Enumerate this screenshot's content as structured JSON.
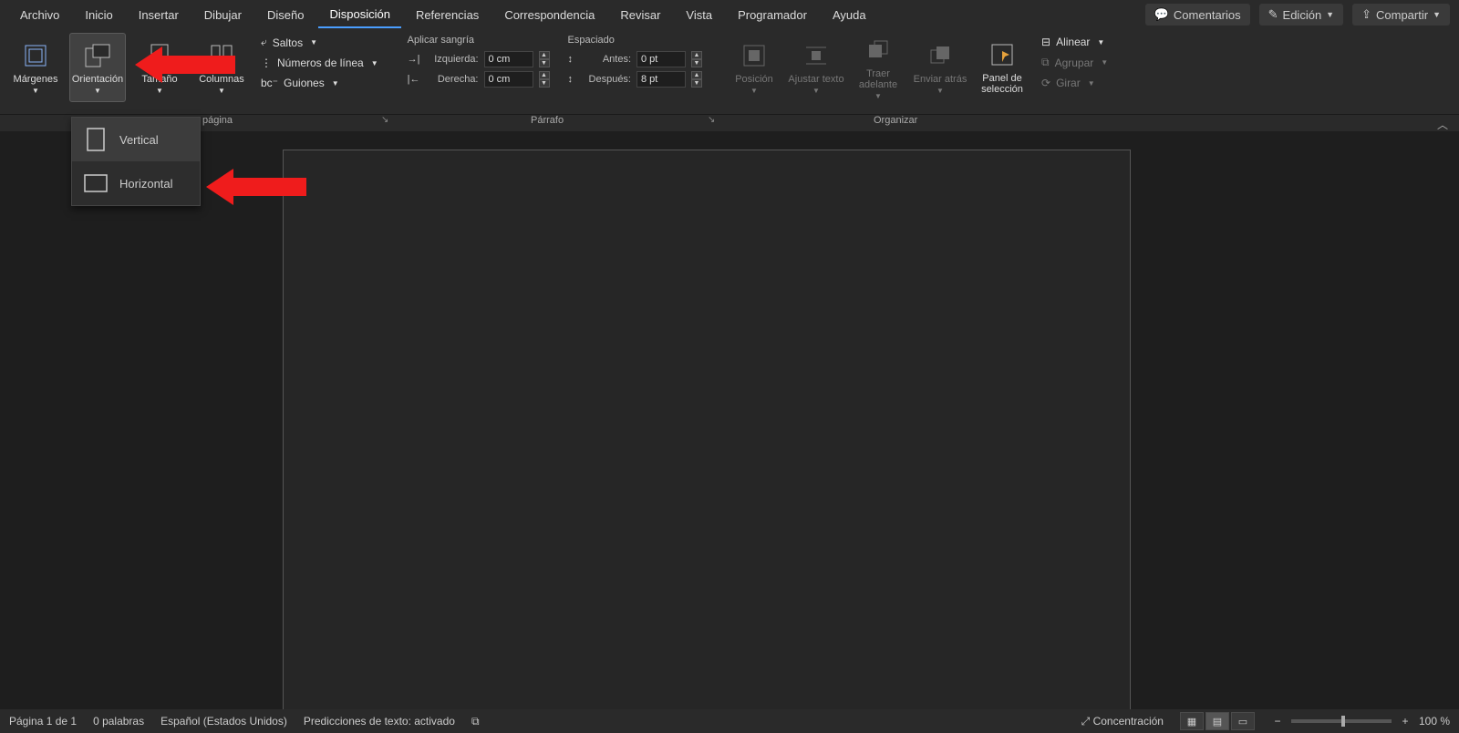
{
  "menu": {
    "tabs": [
      "Archivo",
      "Inicio",
      "Insertar",
      "Dibujar",
      "Diseño",
      "Disposición",
      "Referencias",
      "Correspondencia",
      "Revisar",
      "Vista",
      "Programador",
      "Ayuda"
    ],
    "active": "Disposición",
    "actions": {
      "comments": "Comentarios",
      "editing": "Edición",
      "share": "Compartir"
    }
  },
  "ribbon": {
    "page_setup": {
      "margins": "Márgenes",
      "orientation": "Orientación",
      "size": "Tamaño",
      "columns": "Columnas",
      "breaks": "Saltos",
      "line_numbers": "Números de línea",
      "hyphenation": "Guiones",
      "group_label": "página"
    },
    "paragraph": {
      "indent_header": "Aplicar sangría",
      "spacing_header": "Espaciado",
      "left_label": "Izquierda:",
      "right_label": "Derecha:",
      "before_label": "Antes:",
      "after_label": "Después:",
      "left_val": "0 cm",
      "right_val": "0 cm",
      "before_val": "0 pt",
      "after_val": "8 pt",
      "group_label": "Párrafo"
    },
    "arrange": {
      "position": "Posición",
      "wrap": "Ajustar texto",
      "bring": "Traer adelante",
      "send": "Enviar atrás",
      "selection": "Panel de selección",
      "align": "Alinear",
      "group": "Agrupar",
      "rotate": "Girar",
      "group_label": "Organizar"
    }
  },
  "dropdown": {
    "vertical": "Vertical",
    "horizontal": "Horizontal"
  },
  "status": {
    "page": "Página 1 de 1",
    "words": "0 palabras",
    "lang": "Español (Estados Unidos)",
    "predictions": "Predicciones de texto: activado",
    "focus": "Concentración",
    "zoom": "100 %"
  }
}
